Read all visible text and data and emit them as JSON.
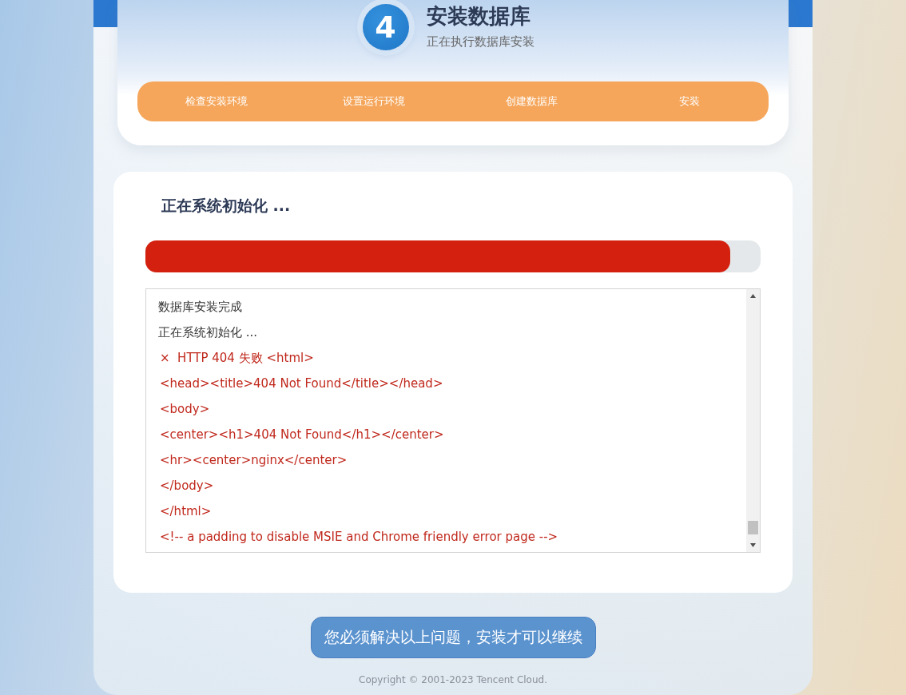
{
  "header": {
    "step_number": "4",
    "title": "安装数据库",
    "subtitle": "正在执行数据库安装"
  },
  "steps": [
    {
      "label": "检查安装环境"
    },
    {
      "label": "设置运行环境"
    },
    {
      "label": "创建数据库"
    },
    {
      "label": "安装"
    }
  ],
  "progress": {
    "title": "正在系统初始化 ...",
    "level": 0.95
  },
  "log": [
    {
      "kind": "info",
      "text": "数据库安装完成"
    },
    {
      "kind": "info",
      "text": "正在系统初始化 ..."
    },
    {
      "kind": "error",
      "text": "×  HTTP 404 失败 <html>"
    },
    {
      "kind": "error",
      "text": "<head><title>404 Not Found</title></head>"
    },
    {
      "kind": "error",
      "text": "<body>"
    },
    {
      "kind": "error",
      "text": "<center><h1>404 Not Found</h1></center>"
    },
    {
      "kind": "error",
      "text": "<hr><center>nginx</center>"
    },
    {
      "kind": "error",
      "text": "</body>"
    },
    {
      "kind": "error",
      "text": "</html>"
    },
    {
      "kind": "error",
      "text": "<!-- a padding to disable MSIE and Chrome friendly error page -->"
    }
  ],
  "action_button": "您必须解决以上问题，安装才可以继续",
  "copyright": "Copyright © 2001-2023 Tencent Cloud."
}
